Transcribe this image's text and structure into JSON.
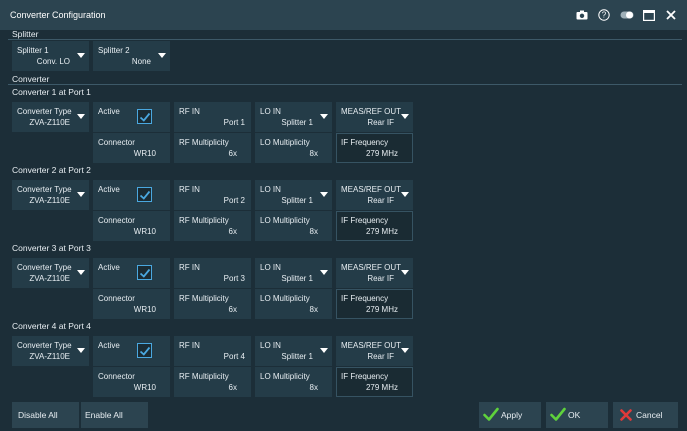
{
  "window": {
    "title": "Converter Configuration",
    "icons": [
      "camera-icon",
      "help-icon",
      "toggle-icon",
      "maximize-icon",
      "close-icon"
    ]
  },
  "splitter": {
    "section_label": "Splitter",
    "splitter1": {
      "label": "Splitter 1",
      "value": "Conv. LO"
    },
    "splitter2": {
      "label": "Splitter 2",
      "value": "None"
    }
  },
  "converter_section_label": "Converter",
  "converters": [
    {
      "heading": "Converter 1 at Port 1",
      "type_label": "Converter Type",
      "type_value": "ZVA-Z110E",
      "active_label": "Active",
      "active": true,
      "rf_in_label": "RF IN",
      "rf_in_value": "Port 1",
      "lo_in_label": "LO IN",
      "lo_in_value": "Splitter 1",
      "meas_label": "MEAS/REF OUT",
      "meas_value": "Rear IF",
      "connector_label": "Connector",
      "connector_value": "WR10",
      "rf_mult_label": "RF Multiplicity",
      "rf_mult_value": "6x",
      "lo_mult_label": "LO Multiplicity",
      "lo_mult_value": "8x",
      "if_freq_label": "IF Frequency",
      "if_freq_value": "279 MHz"
    },
    {
      "heading": "Converter 2 at Port 2",
      "type_label": "Converter Type",
      "type_value": "ZVA-Z110E",
      "active_label": "Active",
      "active": true,
      "rf_in_label": "RF IN",
      "rf_in_value": "Port 2",
      "lo_in_label": "LO IN",
      "lo_in_value": "Splitter 1",
      "meas_label": "MEAS/REF OUT",
      "meas_value": "Rear IF",
      "connector_label": "Connector",
      "connector_value": "WR10",
      "rf_mult_label": "RF Multiplicity",
      "rf_mult_value": "6x",
      "lo_mult_label": "LO Multiplicity",
      "lo_mult_value": "8x",
      "if_freq_label": "IF Frequency",
      "if_freq_value": "279 MHz"
    },
    {
      "heading": "Converter 3 at Port 3",
      "type_label": "Converter Type",
      "type_value": "ZVA-Z110E",
      "active_label": "Active",
      "active": true,
      "rf_in_label": "RF IN",
      "rf_in_value": "Port 3",
      "lo_in_label": "LO IN",
      "lo_in_value": "Splitter 1",
      "meas_label": "MEAS/REF OUT",
      "meas_value": "Rear IF",
      "connector_label": "Connector",
      "connector_value": "WR10",
      "rf_mult_label": "RF Multiplicity",
      "rf_mult_value": "6x",
      "lo_mult_label": "LO Multiplicity",
      "lo_mult_value": "8x",
      "if_freq_label": "IF Frequency",
      "if_freq_value": "279 MHz"
    },
    {
      "heading": "Converter 4 at Port 4",
      "type_label": "Converter Type",
      "type_value": "ZVA-Z110E",
      "active_label": "Active",
      "active": true,
      "rf_in_label": "RF IN",
      "rf_in_value": "Port 4",
      "lo_in_label": "LO IN",
      "lo_in_value": "Splitter 1",
      "meas_label": "MEAS/REF OUT",
      "meas_value": "Rear IF",
      "connector_label": "Connector",
      "connector_value": "WR10",
      "rf_mult_label": "RF Multiplicity",
      "rf_mult_value": "6x",
      "lo_mult_label": "LO Multiplicity",
      "lo_mult_value": "8x",
      "if_freq_label": "IF Frequency",
      "if_freq_value": "279 MHz"
    }
  ],
  "buttons": {
    "disable_all": "Disable All",
    "enable_all": "Enable All",
    "apply": "Apply",
    "ok": "OK",
    "cancel": "Cancel"
  },
  "colors": {
    "background": "#1c2e38",
    "titlebar": "#2c4450",
    "accent_green": "#5fd23c",
    "accent_red": "#e03a3a",
    "checkbox_blue": "#4aa8e0"
  }
}
